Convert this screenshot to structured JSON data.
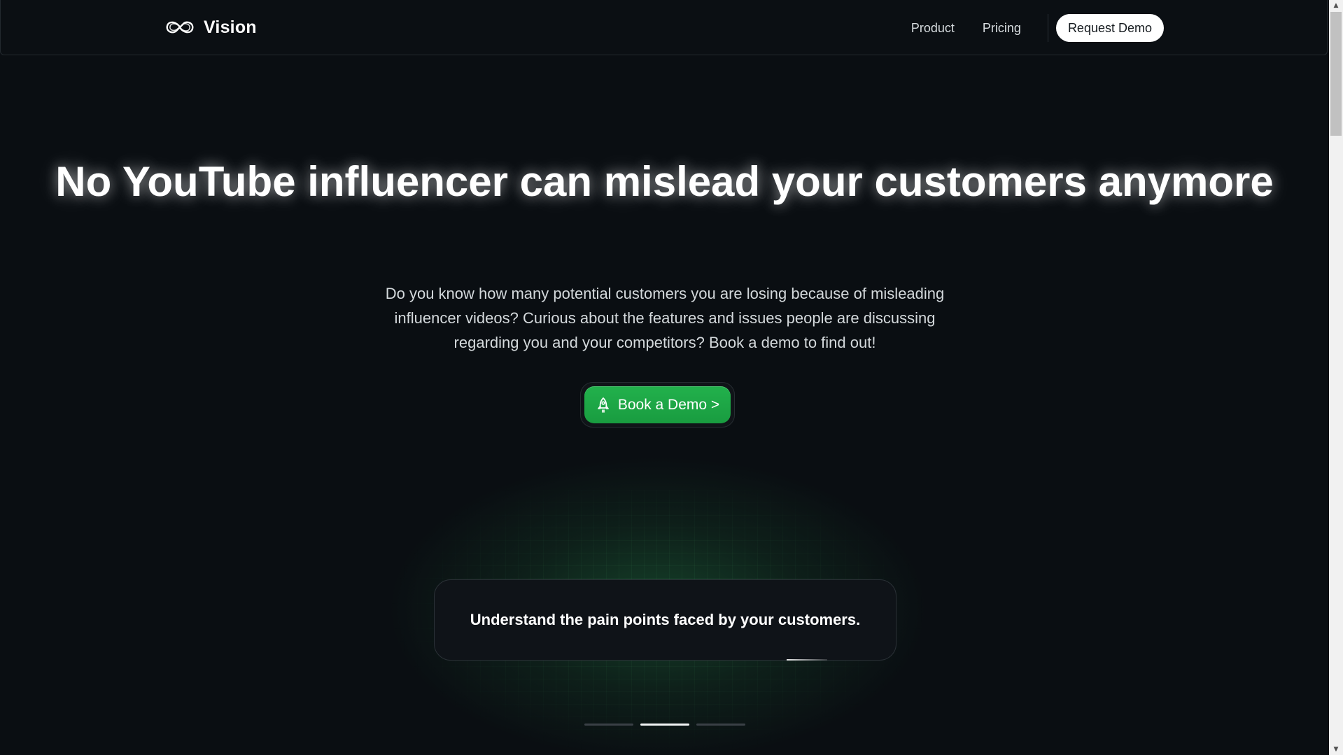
{
  "nav": {
    "brand": "Vision",
    "links": [
      "Product",
      "Pricing"
    ],
    "cta": "Request Demo"
  },
  "hero": {
    "title": "No YouTube influencer can mislead your customers anymore",
    "subtitle": "Do you know how many potential customers you are losing because of misleading influencer videos? Curious about the features and issues people are discussing regarding you and your competitors? Book a demo to find out!",
    "cta": "Book a Demo >"
  },
  "feature": {
    "text": "Understand the pain points faced by your customers.",
    "slides": 3,
    "active_slide": 2
  },
  "icons": {
    "logo": "infinity-icon",
    "cta": "rocket-icon"
  },
  "colors": {
    "background": "#0a0e12",
    "accent": "#1fa846",
    "text": "#ffffff"
  }
}
